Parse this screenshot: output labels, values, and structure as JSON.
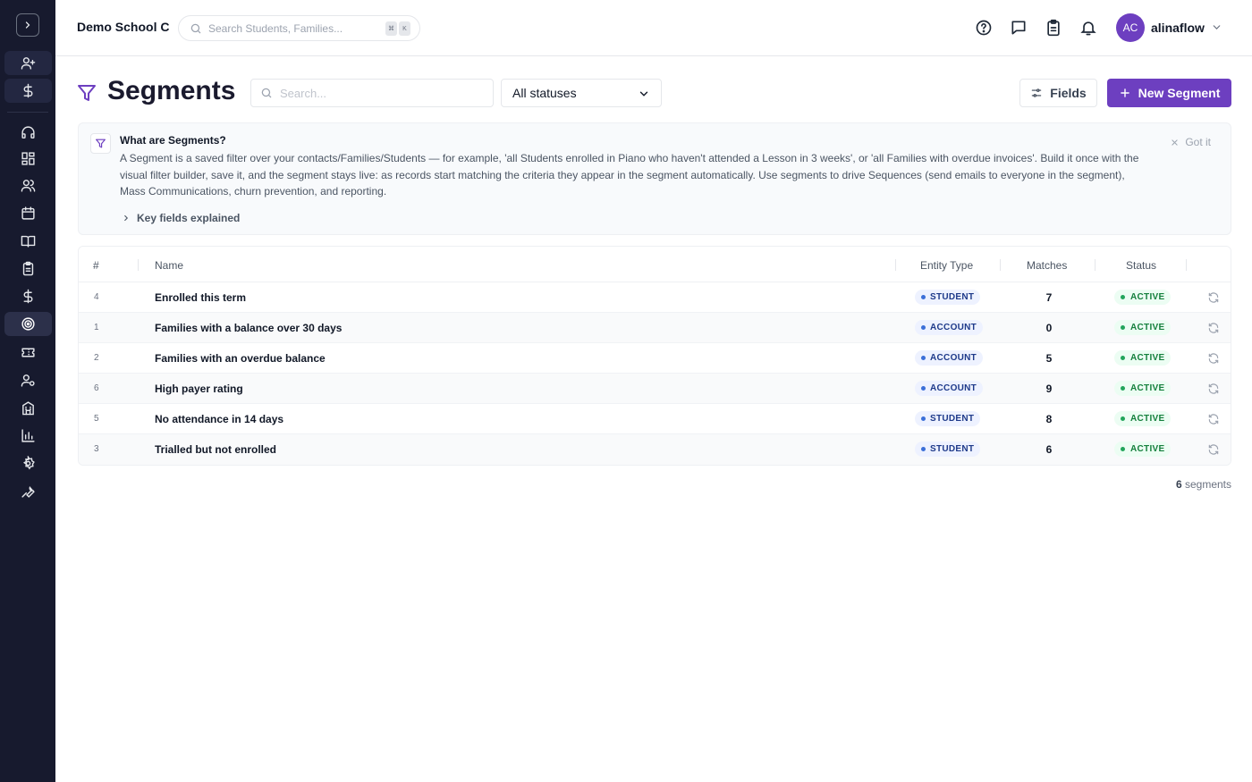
{
  "topbar": {
    "school_name": "Demo School C",
    "search_placeholder": "Search Students, Families...",
    "kbd": [
      "⌘",
      "K"
    ],
    "user": {
      "initials": "AC",
      "name": "alinaflow"
    }
  },
  "sidebar": {
    "items": [
      {
        "name": "add-contact",
        "icon": "user-plus-icon"
      },
      {
        "name": "billing-quick",
        "icon": "dollar-icon"
      },
      {
        "name": "support",
        "icon": "headset-icon"
      },
      {
        "name": "dashboard",
        "icon": "grid-icon"
      },
      {
        "name": "people",
        "icon": "users-icon"
      },
      {
        "name": "calendar",
        "icon": "calendar-icon"
      },
      {
        "name": "courses",
        "icon": "book-icon"
      },
      {
        "name": "tasks",
        "icon": "clipboard-icon"
      },
      {
        "name": "payments",
        "icon": "dollar-icon"
      },
      {
        "name": "segments",
        "icon": "target-icon"
      },
      {
        "name": "tickets",
        "icon": "ticket-icon"
      },
      {
        "name": "staff",
        "icon": "user-cog-icon"
      },
      {
        "name": "locations",
        "icon": "building-icon"
      },
      {
        "name": "reports",
        "icon": "bar-chart-icon"
      },
      {
        "name": "settings",
        "icon": "gear-icon"
      },
      {
        "name": "tools",
        "icon": "wrench-icon"
      }
    ]
  },
  "page": {
    "title": "Segments",
    "search_placeholder": "Search...",
    "status_filter": "All statuses",
    "fields_label": "Fields",
    "new_label": "New Segment"
  },
  "info": {
    "title": "What are Segments?",
    "body": "A Segment is a saved filter over your contacts/Families/Students — for example, 'all Students enrolled in Piano who haven't attended a Lesson in 3 weeks', or 'all Families with overdue invoices'. Build it once with the visual filter builder, save it, and the segment stays live: as records start matching the criteria they appear in the segment automatically. Use segments to drive Sequences (send emails to everyone in the segment), Mass Communications, churn prevention, and reporting.",
    "more": "Key fields explained",
    "dismiss": "Got it"
  },
  "table": {
    "headers": {
      "num": "#",
      "name": "Name",
      "entity": "Entity Type",
      "matches": "Matches",
      "status": "Status"
    },
    "rows": [
      {
        "num": "4",
        "name": "Enrolled this term",
        "entity": "STUDENT",
        "matches": "7",
        "status": "ACTIVE"
      },
      {
        "num": "1",
        "name": "Families with a balance over 30 days",
        "entity": "ACCOUNT",
        "matches": "0",
        "status": "ACTIVE"
      },
      {
        "num": "2",
        "name": "Families with an overdue balance",
        "entity": "ACCOUNT",
        "matches": "5",
        "status": "ACTIVE"
      },
      {
        "num": "6",
        "name": "High payer rating",
        "entity": "ACCOUNT",
        "matches": "9",
        "status": "ACTIVE"
      },
      {
        "num": "5",
        "name": "No attendance in 14 days",
        "entity": "STUDENT",
        "matches": "8",
        "status": "ACTIVE"
      },
      {
        "num": "3",
        "name": "Trialled but not enrolled",
        "entity": "STUDENT",
        "matches": "6",
        "status": "ACTIVE"
      }
    ]
  },
  "footer": {
    "count": "6",
    "count_label": "segments"
  },
  "colors": {
    "sidebar": "#171a2e",
    "accent": "#6d3fc0",
    "active_green": "#15803d",
    "entity_blue": "#1e3a8a"
  }
}
